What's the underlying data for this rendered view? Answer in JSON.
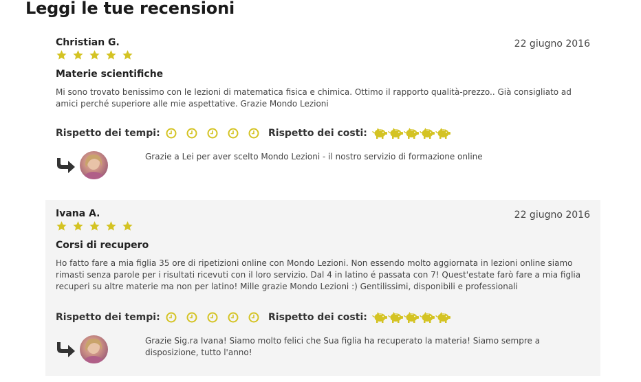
{
  "page": {
    "title": "Leggi le tue recensioni"
  },
  "colors": {
    "accent": "#d4c323",
    "reply_arrow": "#333333",
    "alt_background": "#f4f4f4"
  },
  "reviews": [
    {
      "author": "Christian G.",
      "date": "22 giugno 2016",
      "stars": 5,
      "subject": "Materie scientifiche",
      "text": "Mi sono trovato benissimo con le lezioni di matematica fisica e chimica. Ottimo il rapporto qualità-prezzo.. Già consigliato ad amici perché superiore alle mie aspettative. Grazie Mondo Lezioni",
      "time_label": "Rispetto dei tempi:",
      "time_rating": 5,
      "cost_label": "Rispetto dei costi:",
      "cost_rating": 5,
      "reply": "Grazie a Lei per aver scelto Mondo Lezioni - il nostro servizio di formazione online"
    },
    {
      "author": "Ivana A.",
      "date": "22 giugno 2016",
      "stars": 5,
      "subject": "Corsi di recupero",
      "text": "Ho fatto fare a mia figlia 35 ore di ripetizioni online con Mondo Lezioni. Non essendo molto aggiornata in lezioni online siamo rimasti senza parole per i risultati ricevuti con il loro servizio. Dal 4 in latino é passata con 7! Quest'estate farò fare a mia figlia recuperi su altre materie ma non per latino! Mille grazie Mondo Lezioni :) Gentilissimi, disponibili e professionali",
      "time_label": "Rispetto dei tempi:",
      "time_rating": 5,
      "cost_label": "Rispetto dei costi:",
      "cost_rating": 5,
      "reply": "Grazie Sig.ra Ivana! Siamo molto felici che Sua figlia ha recuperato la materia! Siamo sempre a disposizione, tutto l'anno!"
    }
  ]
}
